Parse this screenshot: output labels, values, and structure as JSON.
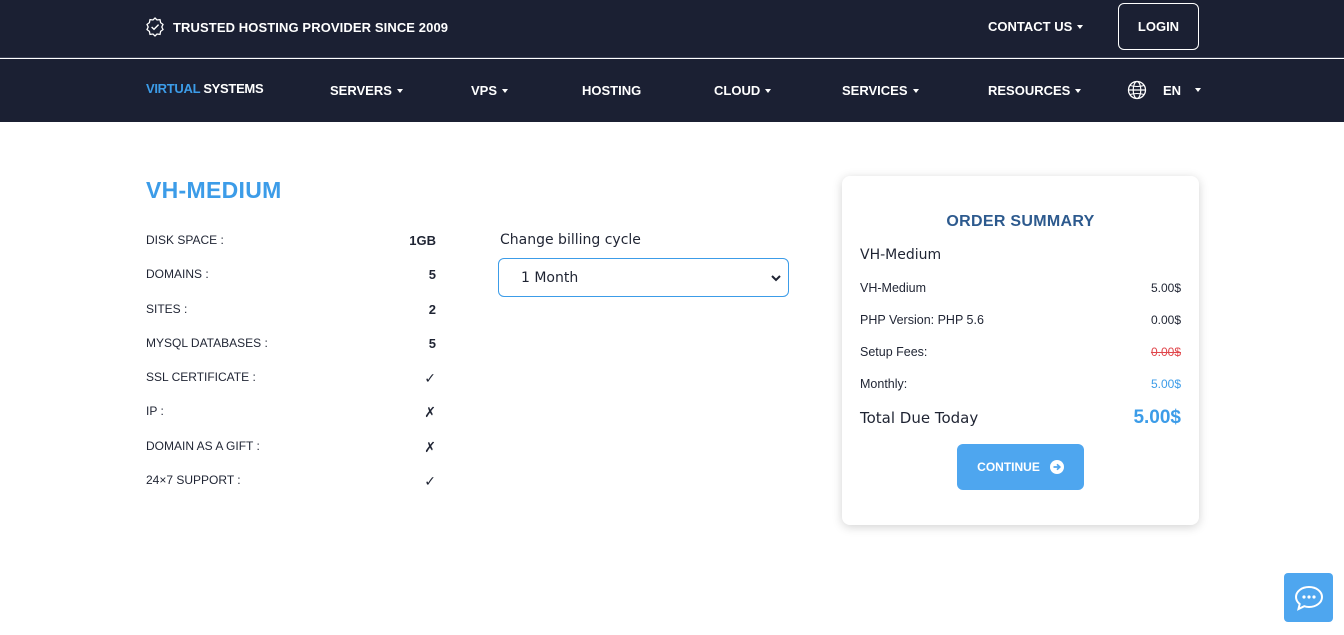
{
  "topbar": {
    "trusted_text": "TRUSTED HOSTING PROVIDER SINCE 2009",
    "contact_label": "CONTACT US",
    "login_label": "LOGIN"
  },
  "nav": {
    "logo_virtual": "VIRTUAL",
    "logo_systems": "SYSTEMS",
    "items": [
      {
        "label": "SERVERS"
      },
      {
        "label": "VPS"
      },
      {
        "label": "HOSTING"
      },
      {
        "label": "CLOUD"
      },
      {
        "label": "SERVICES"
      },
      {
        "label": "RESOURCES"
      }
    ],
    "language": "EN"
  },
  "product": {
    "title": "VH-MEDIUM",
    "specs": [
      {
        "label": "DISK SPACE :",
        "value": "1GB"
      },
      {
        "label": "DOMAINS :",
        "value": "5"
      },
      {
        "label": "SITES :",
        "value": "2"
      },
      {
        "label": "MYSQL DATABASES :",
        "value": "5"
      },
      {
        "label": "SSL CERTIFICATE :",
        "value": "✓"
      },
      {
        "label": "IP :",
        "value": "✗"
      },
      {
        "label": "DOMAIN AS A GIFT :",
        "value": "✗"
      },
      {
        "label": "24×7 SUPPORT :",
        "value": "✓"
      }
    ]
  },
  "billing": {
    "label": "Change billing cycle",
    "selected": "1 Month"
  },
  "summary": {
    "title": "ORDER SUMMARY",
    "product_name": "VH-Medium",
    "lines": [
      {
        "label": "VH-Medium",
        "amount": "5.00$"
      },
      {
        "label": "PHP Version: PHP 5.6",
        "amount": "0.00$"
      },
      {
        "label": "Setup Fees:",
        "amount": "0.00$"
      },
      {
        "label": "Monthly:",
        "amount": "5.00$"
      }
    ],
    "total_label": "Total Due Today",
    "total_amount": "5.00$",
    "continue_label": "CONTINUE"
  },
  "colors": {
    "navy": "#1b2033",
    "accent_blue": "#3c9ce8",
    "button_blue": "#4ea6ef",
    "strike_red": "#e0464b",
    "summary_title": "#2d5a8e"
  }
}
